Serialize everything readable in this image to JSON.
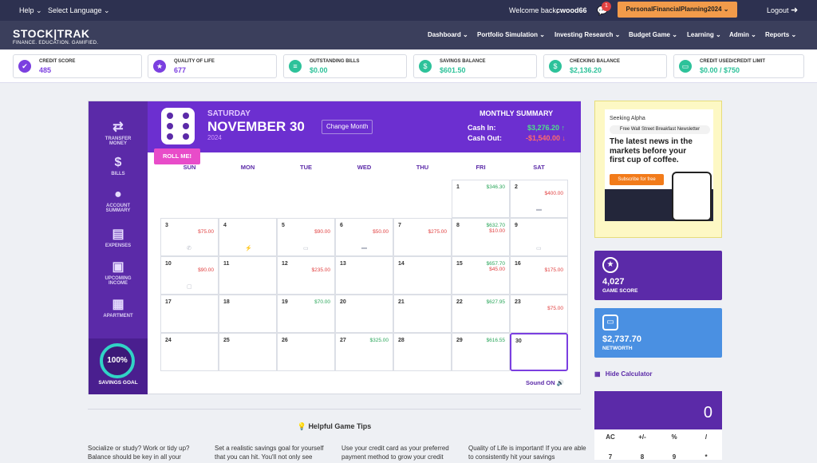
{
  "topbar": {
    "help": "Help ⌄",
    "language": "Select Language ⌄",
    "welcome_prefix": "Welcome back,",
    "username": "cwood66",
    "notif_count": "1",
    "game_name": "PersonalFinancialPlanning2024 ⌄",
    "logout": "Logout"
  },
  "brand": {
    "name": "STOCK|TRAK",
    "tagline": "FINANCE. EDUCATION. GAMIFIED."
  },
  "nav": [
    "Dashboard ⌄",
    "Portfolio Simulation ⌄",
    "Investing Research ⌄",
    "Budget Game ⌄",
    "Learning ⌄",
    "Admin ⌄",
    "Reports ⌄"
  ],
  "stats": [
    {
      "label": "CREDIT SCORE",
      "value": "485",
      "color": "#7b3fe0"
    },
    {
      "label": "QUALITY OF LIFE",
      "value": "677",
      "color": "#7b3fe0"
    },
    {
      "label": "OUTSTANDING BILLS",
      "value": "$0.00",
      "color": "#2dc29a"
    },
    {
      "label": "SAVINGS BALANCE",
      "value": "$601.50",
      "color": "#2dc29a"
    },
    {
      "label": "CHECKING BALANCE",
      "value": "$2,136.20",
      "color": "#2dc29a"
    },
    {
      "label": "CREDIT USED/CREDIT LIMIT",
      "value": "$0.00 / $750",
      "color": "#2dc29a"
    }
  ],
  "sidebar": [
    {
      "label1": "TRANSFER",
      "label2": "MONEY",
      "icon": "transfer-icon"
    },
    {
      "label1": "BILLS",
      "label2": "",
      "icon": "bills-icon"
    },
    {
      "label1": "ACCOUNT",
      "label2": "SUMMARY",
      "icon": "piggy-bank-icon"
    },
    {
      "label1": "EXPENSES",
      "label2": "",
      "icon": "receipt-icon"
    },
    {
      "label1": "UPCOMING",
      "label2": "INCOME",
      "icon": "wallet-icon"
    },
    {
      "label1": "APARTMENT",
      "label2": "",
      "icon": "building-icon"
    }
  ],
  "savings_goal": {
    "percent": "100%",
    "label": "SAVINGS GOAL"
  },
  "calendar": {
    "day_of_week": "SATURDAY",
    "date": "NOVEMBER 30",
    "year": "2024",
    "change_month": "Change Month",
    "roll_me": "ROLL ME!",
    "weekdays": [
      "SUN",
      "MON",
      "TUE",
      "WED",
      "THU",
      "FRI",
      "SAT"
    ],
    "summary_title": "MONTHLY SUMMARY",
    "cash_in_label": "Cash In:",
    "cash_in_value": "$3,276.20 ↑",
    "cash_out_label": "Cash Out:",
    "cash_out_value": "-$1,540.00 ↓",
    "sound": "Sound ON 🔊",
    "cells": [
      {
        "d": "",
        "in": "",
        "out": ""
      },
      {
        "d": "",
        "in": "",
        "out": ""
      },
      {
        "d": "",
        "in": "",
        "out": ""
      },
      {
        "d": "",
        "in": "",
        "out": ""
      },
      {
        "d": "",
        "in": "",
        "out": ""
      },
      {
        "d": "1",
        "in": "$346.30",
        "out": ""
      },
      {
        "d": "2",
        "in": "",
        "out": "$400.00",
        "icon": "car-icon"
      },
      {
        "d": "3",
        "in": "",
        "out": "$75.00",
        "icon": "phone-icon"
      },
      {
        "d": "4",
        "in": "",
        "out": "",
        "icon": "bolt-icon"
      },
      {
        "d": "5",
        "in": "",
        "out": "$90.00",
        "icon": "card-icon"
      },
      {
        "d": "6",
        "in": "",
        "out": "$50.00",
        "icon": "car-icon"
      },
      {
        "d": "7",
        "in": "",
        "out": "$275.00"
      },
      {
        "d": "8",
        "in": "$632.70",
        "out": "$10.00"
      },
      {
        "d": "9",
        "in": "",
        "out": "",
        "icon": "card-icon"
      },
      {
        "d": "10",
        "in": "",
        "out": "$90.00",
        "icon": "folder-icon"
      },
      {
        "d": "11",
        "in": "",
        "out": ""
      },
      {
        "d": "12",
        "in": "",
        "out": "$235.00"
      },
      {
        "d": "13",
        "in": "",
        "out": ""
      },
      {
        "d": "14",
        "in": "",
        "out": ""
      },
      {
        "d": "15",
        "in": "$657.70",
        "out": "$45.00"
      },
      {
        "d": "16",
        "in": "",
        "out": "$175.00"
      },
      {
        "d": "17",
        "in": "",
        "out": ""
      },
      {
        "d": "18",
        "in": "",
        "out": ""
      },
      {
        "d": "19",
        "in": "$70.00",
        "out": ""
      },
      {
        "d": "20",
        "in": "",
        "out": ""
      },
      {
        "d": "21",
        "in": "",
        "out": ""
      },
      {
        "d": "22",
        "in": "$627.95",
        "out": ""
      },
      {
        "d": "23",
        "in": "",
        "out": "$75.00"
      },
      {
        "d": "24",
        "in": "",
        "out": ""
      },
      {
        "d": "25",
        "in": "",
        "out": ""
      },
      {
        "d": "26",
        "in": "",
        "out": ""
      },
      {
        "d": "27",
        "in": "$325.00",
        "out": ""
      },
      {
        "d": "28",
        "in": "",
        "out": ""
      },
      {
        "d": "29",
        "in": "$616.55",
        "out": ""
      },
      {
        "d": "30",
        "in": "",
        "out": "",
        "today": true
      }
    ]
  },
  "tips": {
    "title": "Helpful Game Tips",
    "items": [
      "Socialize or study? Work or tidy up? Balance should be key in all your",
      "Set a realistic savings goal for yourself that you can hit. You'll not only see",
      "Use your credit card as your preferred payment method to grow your credit",
      "Quality of Life is important! If you are able to consistently hit your savings"
    ]
  },
  "ad": {
    "brand": "Seeking Alpha",
    "newsletter": "Free Wall Street Breakfast Newsletter",
    "headline": "The latest news in the markets before your first cup of coffee.",
    "cta": "Subscribe for free"
  },
  "game_score": {
    "value": "4,027",
    "label": "GAME SCORE"
  },
  "networth": {
    "value": "$2,737.70",
    "label": "NETWORTH"
  },
  "calculator": {
    "toggle": "Hide Calculator",
    "display": "0",
    "keys": [
      "AC",
      "+/-",
      "%",
      "/",
      "7",
      "8",
      "9",
      "*"
    ]
  },
  "colors": {
    "purple": "#6c2fd0",
    "income": "#2aa65a",
    "expense": "#e14141",
    "orange": "#f29b4a"
  }
}
